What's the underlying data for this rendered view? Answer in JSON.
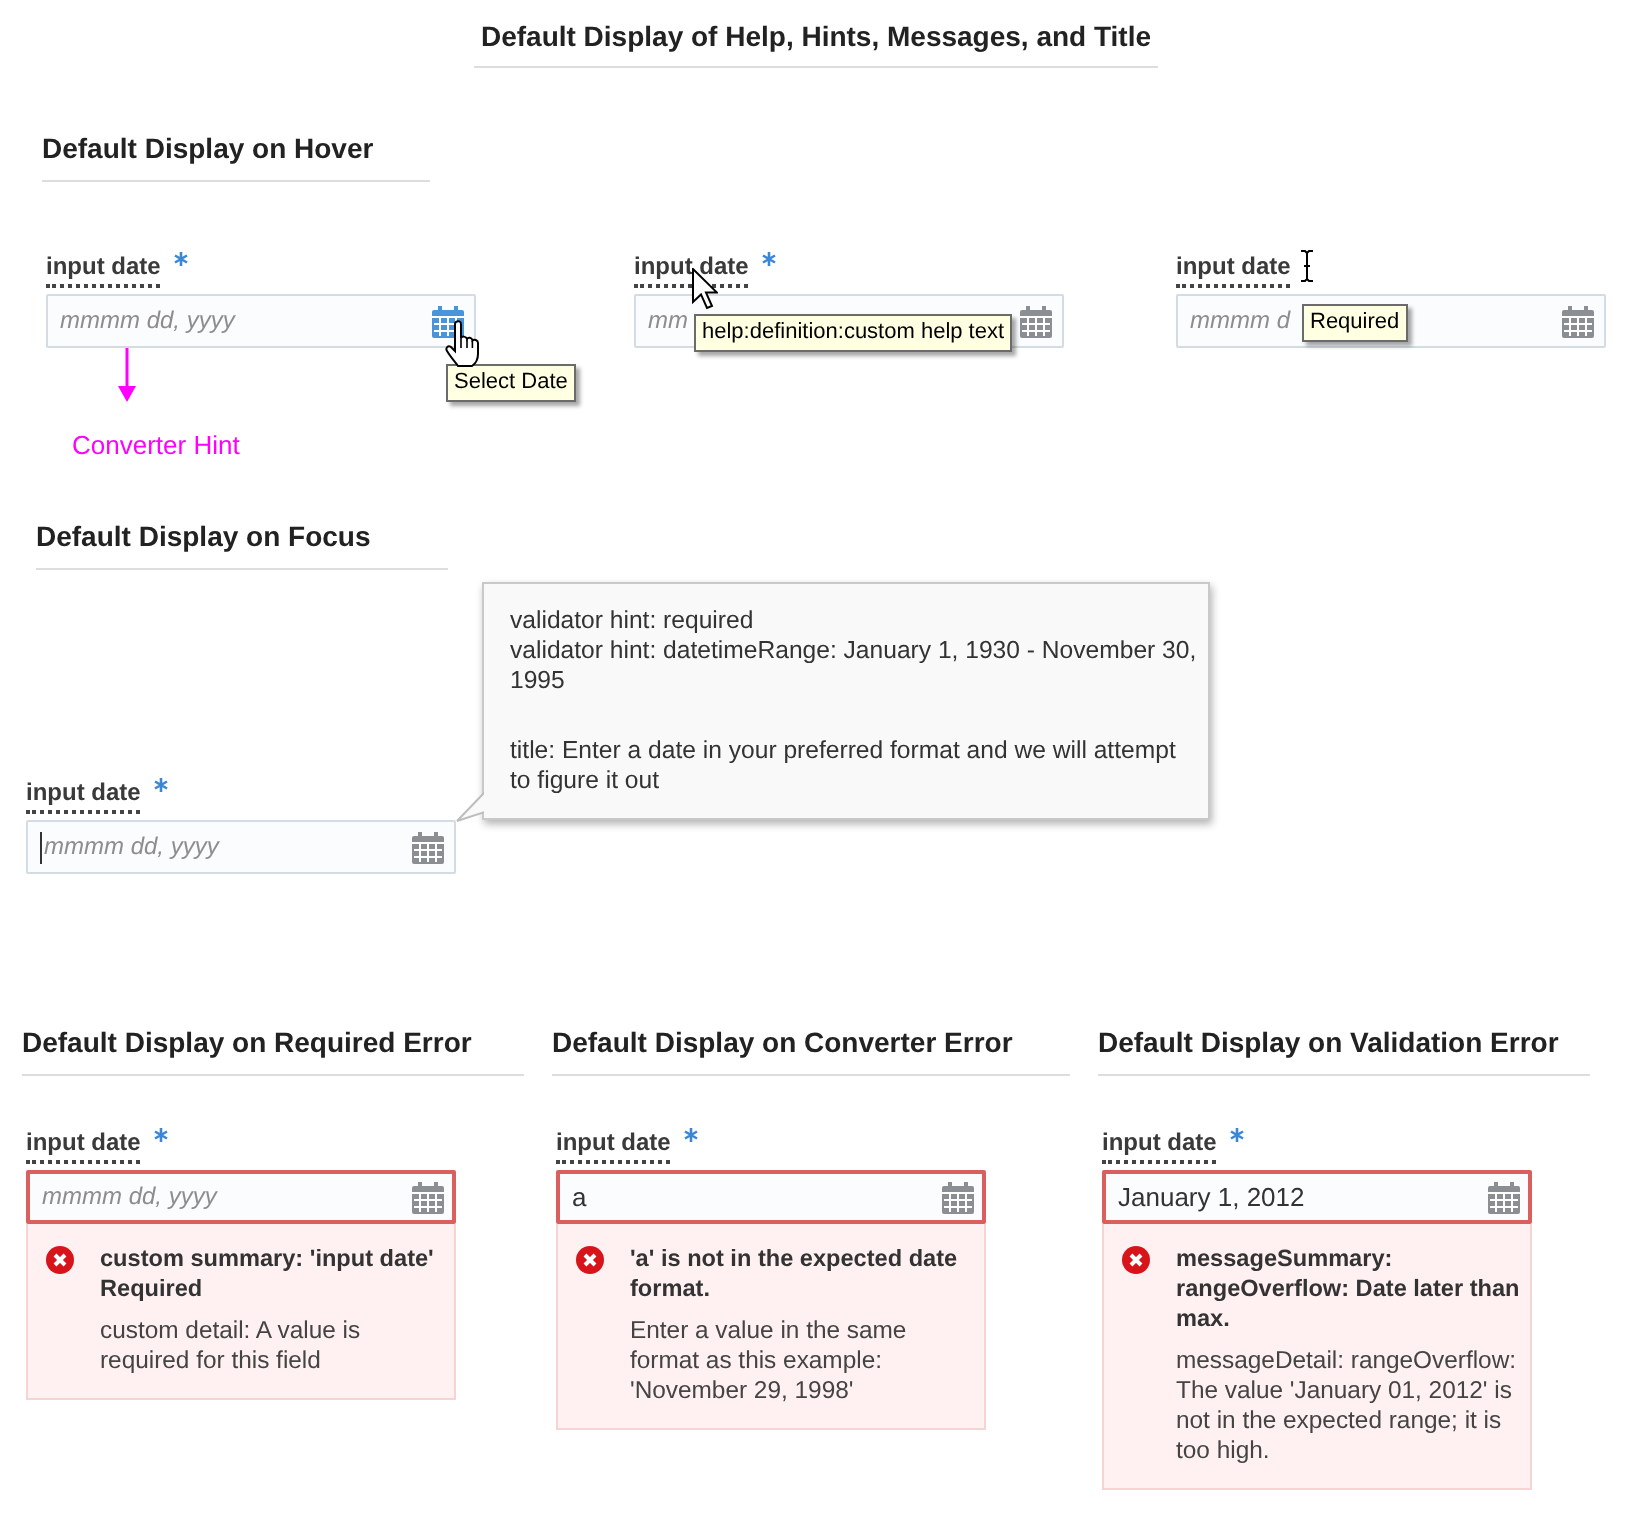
{
  "title": "Default Display of Help, Hints, Messages, and Title",
  "hover": {
    "heading": "Default Display on Hover",
    "fields": [
      {
        "kind": "calendar",
        "label": "input date",
        "required": true,
        "placeholder": "mmmm dd, yyyy",
        "calendar_hovered": true,
        "tooltip": "Select Date",
        "annotation": "Converter Hint"
      },
      {
        "kind": "label",
        "label": "input date",
        "required": true,
        "placeholder": "mm",
        "calendar_hovered": false,
        "tooltip": "help:definition:custom help text"
      },
      {
        "kind": "input",
        "label": "input date",
        "required": false,
        "placeholder": "mmmm d",
        "calendar_hovered": false,
        "tooltip": "Required"
      }
    ]
  },
  "focus": {
    "heading": "Default Display on Focus",
    "field": {
      "label": "input date",
      "required": true,
      "placeholder": "mmmm dd, yyyy",
      "focused": true
    },
    "popup": {
      "hints": [
        "validator hint: required",
        "validator hint: datetimeRange: January 1, 1930 - November 30, 1995"
      ],
      "title": "title: Enter a date in your preferred format and we will attempt to figure it out"
    }
  },
  "errors": [
    {
      "heading": "Default Display on Required Error",
      "field": {
        "label": "input date",
        "required": true,
        "placeholder": "mmmm dd, yyyy",
        "invalid": true
      },
      "message": {
        "summary": "custom summary: 'input date' Required",
        "detail": "custom detail: A value is required for this field"
      }
    },
    {
      "heading": "Default Display on Converter Error",
      "field": {
        "label": "input date",
        "required": true,
        "value": "a",
        "invalid": true
      },
      "message": {
        "summary": "'a' is not in the expected date format.",
        "detail": "Enter a value in the same format as this example: 'November 29, 1998'"
      }
    },
    {
      "heading": "Default Display on Validation Error",
      "field": {
        "label": "input date",
        "required": true,
        "value": "January 1, 2012",
        "invalid": true
      },
      "message": {
        "summary": "messageSummary: rangeOverflow: Date later than max.",
        "detail": "messageDetail: rangeOverflow: The value 'January 01, 2012' is not in the expected range; it is too high."
      }
    }
  ]
}
